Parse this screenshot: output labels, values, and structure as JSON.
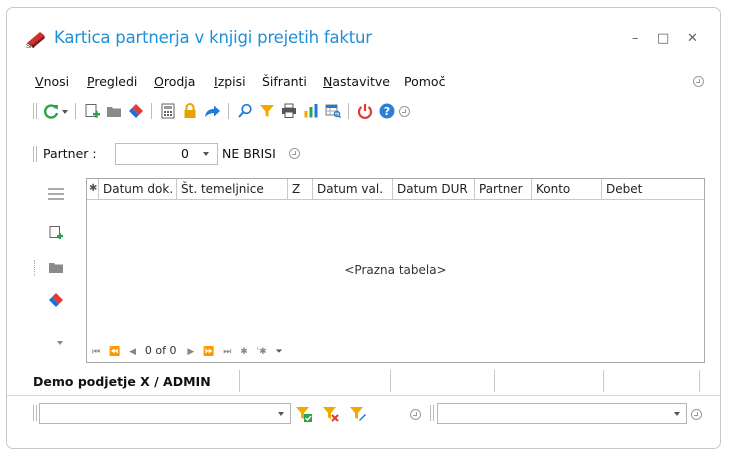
{
  "window": {
    "title": "Kartica partnerja v knjigi prejetih faktur",
    "min_glyph": "–",
    "max_glyph": "□",
    "close_glyph": "✕"
  },
  "menu": [
    {
      "accel": "V",
      "rest": "nosi"
    },
    {
      "accel": "P",
      "rest": "regledi"
    },
    {
      "accel": "O",
      "rest": "rodja"
    },
    {
      "accel": "I",
      "rest": "zpisi"
    },
    {
      "accel": "",
      "rest": "Šifranti"
    },
    {
      "accel": "N",
      "rest": "astavitve"
    },
    {
      "accel": "",
      "rest": "Pomoč"
    }
  ],
  "partner": {
    "label": "Partner :",
    "value": "0",
    "description": "NE BRISI"
  },
  "grid": {
    "columns": [
      "Datum dok.",
      "Št. temeljnice",
      "Z",
      "Datum val.",
      "Datum DUR",
      "Partner",
      "Konto",
      "Debet"
    ],
    "empty_text": "<Prazna tabela>",
    "record_info": "0 of 0"
  },
  "status": {
    "company": "Demo podjetje X / ADMIN"
  },
  "colors": {
    "accent": "#1e8fd8",
    "refresh": "#2aa34a",
    "lock": "#e8a300",
    "power": "#e03a2f",
    "help": "#2b7fd8"
  }
}
